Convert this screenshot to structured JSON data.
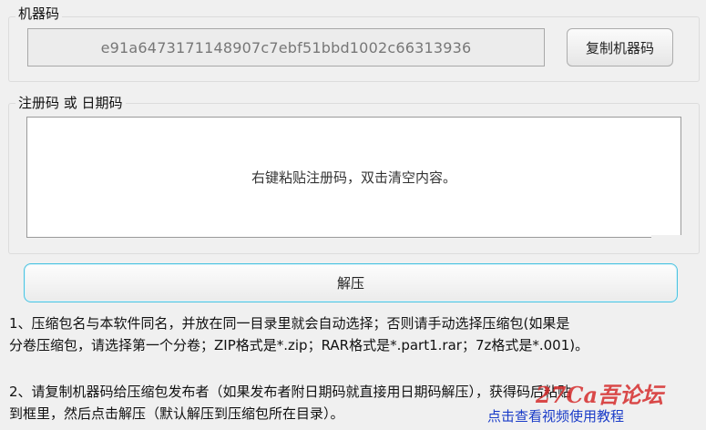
{
  "machine_code": {
    "group_title": "机器码",
    "value": "e91a6473171148907c7ebf51bbd1002c66313936",
    "copy_button_label": "复制机器码"
  },
  "registration": {
    "group_title": "注册码 或 日期码",
    "placeholder": "右键粘贴注册码，双击清空内容。"
  },
  "extract_button_label": "解压",
  "notes": {
    "line1a": "1、压缩包名与本软件同名，并放在同一目录里就会自动选择；否则请手动选择压缩包(如果是",
    "line1b": "分卷压缩包，请选择第一个分卷；ZIP格式是*.zip；RAR格式是*.part1.rar；7z格式是*.001)。",
    "line2a": "2、请复制机器码给压缩包发布者（如果发布者附日期码就直接用日期码解压），获得码后粘贴",
    "line2b": "到框里，然后点击解压（默认解压到压缩包所在目录）。"
  },
  "tutorial_link_label": "点击查看视频使用教程",
  "watermark_text": "27Ca吾论坛"
}
